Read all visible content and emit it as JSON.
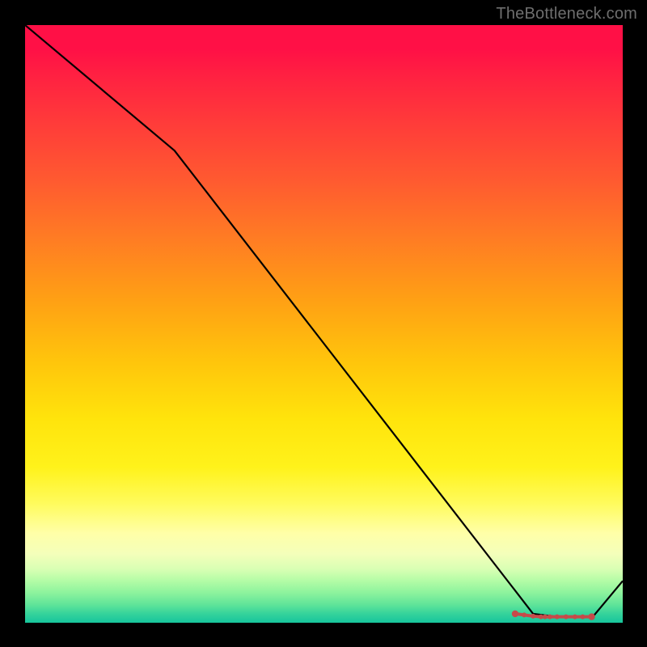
{
  "watermark": "TheBottleneck.com",
  "chart_data": {
    "type": "line",
    "series": [
      {
        "name": "main-line",
        "color": "#000000",
        "x": [
          0.0,
          0.25,
          0.85,
          0.89,
          0.92,
          0.95,
          1.0
        ],
        "y": [
          1.0,
          0.79,
          0.015,
          0.01,
          0.01,
          0.01,
          0.07
        ]
      },
      {
        "name": "dotted-marker",
        "color": "#c64a4a",
        "style": "dotted",
        "x": [
          0.82,
          0.835,
          0.85,
          0.863,
          0.87,
          0.878,
          0.89,
          0.905,
          0.92,
          0.933,
          0.948
        ],
        "y": [
          0.015,
          0.013,
          0.011,
          0.01,
          0.01,
          0.01,
          0.01,
          0.01,
          0.01,
          0.01,
          0.01
        ]
      }
    ],
    "xlim": [
      0,
      1
    ],
    "ylim": [
      0,
      1
    ],
    "title": "",
    "xlabel": "",
    "ylabel": "",
    "background": "red-yellow-green vertical gradient",
    "grid": false,
    "legend": false
  }
}
